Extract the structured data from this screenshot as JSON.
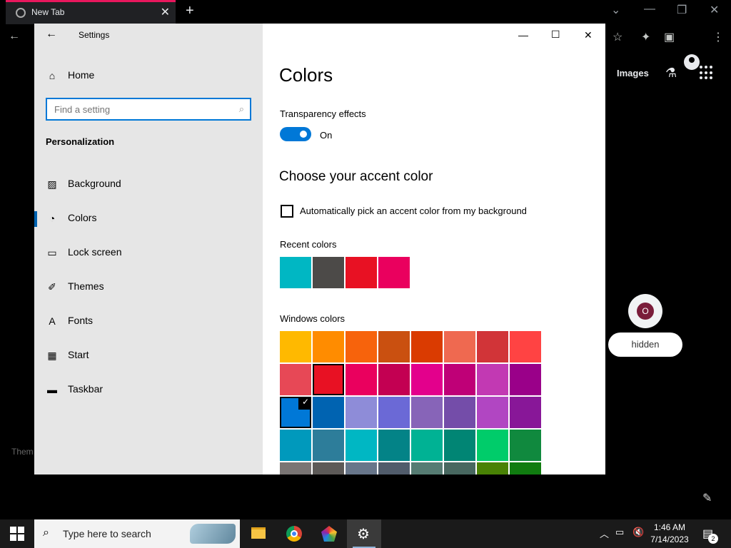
{
  "browser": {
    "tab_title": "New Tab",
    "tab_close": "✕",
    "new_tab": "+",
    "images_link": "Images",
    "shortcut": {
      "initial": "O",
      "label": "hidden"
    },
    "footer_text": "Them"
  },
  "settings": {
    "app_title": "Settings",
    "home_label": "Home",
    "search_placeholder": "Find a setting",
    "section_title": "Personalization",
    "nav": [
      {
        "label": "Background",
        "icon": "image-icon"
      },
      {
        "label": "Colors",
        "icon": "palette-icon"
      },
      {
        "label": "Lock screen",
        "icon": "monitor-lock-icon"
      },
      {
        "label": "Themes",
        "icon": "brush-icon"
      },
      {
        "label": "Fonts",
        "icon": "font-icon"
      },
      {
        "label": "Start",
        "icon": "start-layout-icon"
      },
      {
        "label": "Taskbar",
        "icon": "taskbar-icon"
      }
    ],
    "active_nav": "Colors",
    "page_title": "Colors",
    "transparency_label": "Transparency effects",
    "toggle_state": "On",
    "accent_title": "Choose your accent color",
    "auto_pick_label": "Automatically pick an accent color from my background",
    "recent_label": "Recent colors",
    "recent_colors": [
      "#00b7c3",
      "#4c4a48",
      "#e81123",
      "#ea005e"
    ],
    "windows_label": "Windows colors",
    "windows_colors": [
      "#ffb900",
      "#ff8c00",
      "#f7630c",
      "#ca5010",
      "#da3b01",
      "#ef6950",
      "#d13438",
      "#ff4343",
      "#e74856",
      "#e81123",
      "#ea005e",
      "#c30052",
      "#e3008c",
      "#bf0077",
      "#c239b3",
      "#9a0089",
      "#0078d7",
      "#0063b1",
      "#8e8cd8",
      "#6b69d6",
      "#8764b8",
      "#744da9",
      "#b146c2",
      "#881798",
      "#0099bc",
      "#2d7d9a",
      "#00b7c3",
      "#038387",
      "#00b294",
      "#018574",
      "#00cc6a",
      "#10893e",
      "#7a7574",
      "#5d5a58",
      "#68768a",
      "#515c6b",
      "#567c73",
      "#486860",
      "#498205",
      "#107c10"
    ],
    "selected_color_index": 9,
    "checked_color_index": 16
  },
  "taskbar": {
    "search_text": "Type here to search",
    "time": "1:46 AM",
    "date": "7/14/2023",
    "notification_count": "2"
  }
}
